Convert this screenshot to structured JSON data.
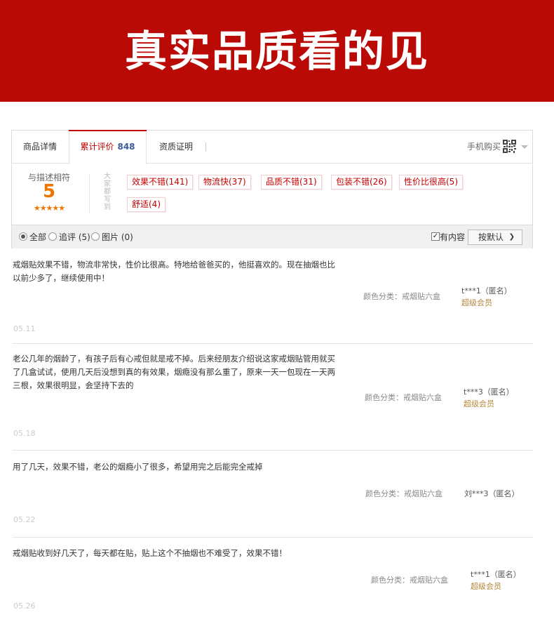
{
  "banner": {
    "title": "真实品质看的见"
  },
  "tabs": {
    "detail": "商品详情",
    "reviews": "累计评价",
    "reviews_count": "848",
    "quality": "资质证明",
    "mobile_buy": "手机购买"
  },
  "summary": {
    "rating_label": "与描述相符",
    "rating_score": "5",
    "rating_stars": "★★★★★",
    "vertical_caption": "大家都写到",
    "tags": [
      "效果不错(141)",
      "物流快(37)",
      "品质不错(31)",
      "包装不错(26)",
      "性价比很高(5)",
      "舒适(4)"
    ]
  },
  "filters": {
    "all": "全部",
    "followup": "追评 (5)",
    "images": "图片 (0)",
    "has_content": "有内容",
    "sort": "按默认"
  },
  "reviews": [
    {
      "text": "戒烟贴效果不错，物流非常快，性价比很高。特地给爸爸买的，他挺喜欢的。现在抽烟也比以前少多了，继续使用中！",
      "sku": "颜色分类：戒烟贴六盒",
      "user": "t***1（匿名）",
      "vip": "超级会员",
      "date": "05.11"
    },
    {
      "text": "老公几年的烟龄了，有孩子后有心戒但就是戒不掉。后来经朋友介绍说这家戒烟贴管用就买了几盒试试，使用几天后没想到真的有效果，烟瘾没有那么重了，原来一天一包现在一天两三根，效果很明显，会坚持下去的",
      "sku": "颜色分类：戒烟贴六盒",
      "user": "t***3（匿名）",
      "vip": "超级会员",
      "date": "05.18"
    },
    {
      "text": "用了几天，效果不错，老公的烟瘾小了很多，希望用完之后能完全戒掉",
      "sku": "颜色分类：戒烟贴六盒",
      "user": "刘***3（匿名）",
      "vip": "",
      "date": "05.22"
    },
    {
      "text": "戒烟贴收到好几天了，每天都在贴，贴上这个不抽烟也不难受了，效果不错！",
      "sku": "颜色分类：戒烟贴六盒",
      "user": "t***1（匿名）",
      "vip": "超级会员",
      "date": "05.26"
    }
  ],
  "colors": {
    "banner": "#b90a06",
    "accent": "#c40000",
    "score": "#ee7600",
    "count": "#3c5a9a",
    "vip": "#b5873b"
  }
}
